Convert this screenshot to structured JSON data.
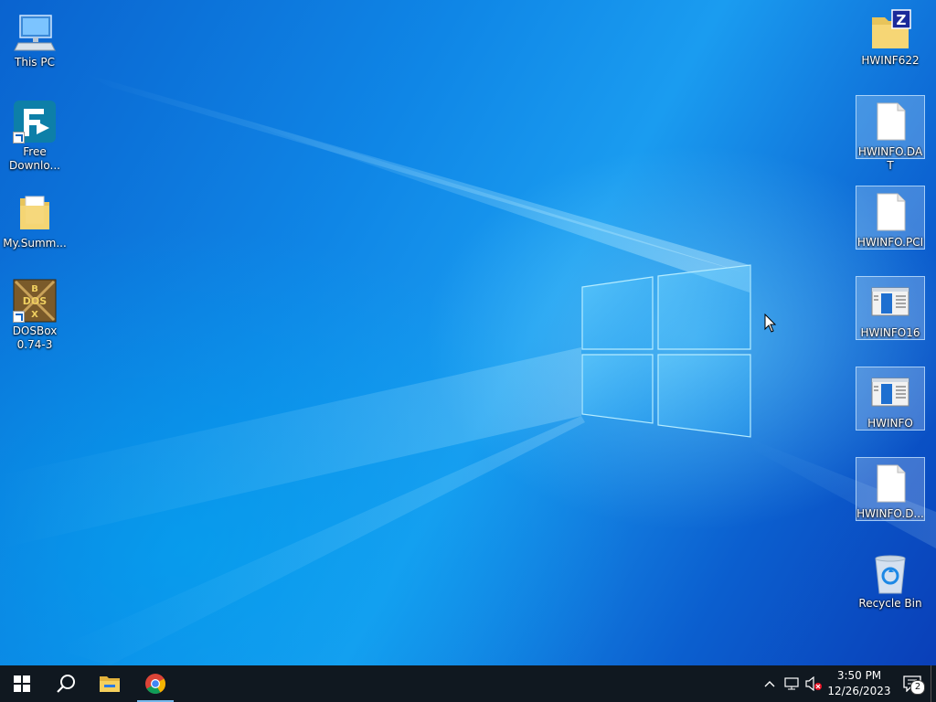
{
  "desktop": {
    "left_icons": [
      {
        "name": "this-pc",
        "label": "This PC",
        "icon": "computer-icon",
        "shortcut": false
      },
      {
        "name": "free-download-manager",
        "label": "Free Downlo...",
        "icon": "fdm-icon",
        "shortcut": true
      },
      {
        "name": "my-summ-folder",
        "label": "My.Summ...",
        "icon": "folder-icon",
        "shortcut": false
      },
      {
        "name": "dosbox",
        "label": "DOSBox 0.74-3",
        "icon": "dosbox-icon",
        "shortcut": true
      }
    ],
    "right_icons": [
      {
        "name": "hwinf622",
        "label": "HWINF622",
        "icon": "zip-folder-icon",
        "selected": false
      },
      {
        "name": "hwinfo-dat",
        "label": "HWINFO.DAT",
        "icon": "file-icon",
        "selected": true
      },
      {
        "name": "hwinfo-pci",
        "label": "HWINFO.PCI",
        "icon": "file-icon",
        "selected": true
      },
      {
        "name": "hwinfo16",
        "label": "HWINFO16",
        "icon": "app-window-icon",
        "selected": true
      },
      {
        "name": "hwinfo",
        "label": "HWINFO",
        "icon": "app-window-icon",
        "selected": true
      },
      {
        "name": "hwinfo-d",
        "label": "HWINFO.D...",
        "icon": "file-icon",
        "selected": true
      },
      {
        "name": "recycle-bin",
        "label": "Recycle Bin",
        "icon": "recycle-bin-icon",
        "selected": false
      }
    ],
    "cursor": "mouse-pointer-icon"
  },
  "taskbar": {
    "start": "windows-start-icon",
    "search": "search-icon",
    "pinned": [
      {
        "name": "file-explorer",
        "icon": "folder-icon"
      },
      {
        "name": "chrome",
        "icon": "chrome-icon",
        "active": true
      }
    ],
    "tray": {
      "icons": [
        "chevron-up-icon",
        "network-icon",
        "speaker-muted-icon"
      ],
      "time": "3:50 PM",
      "date": "12/26/2023",
      "notification_count": "2"
    }
  },
  "colors": {
    "taskbar_bg": "#101820",
    "desktop_blue": "#0a6fd6",
    "selection": "#76b9ed"
  }
}
